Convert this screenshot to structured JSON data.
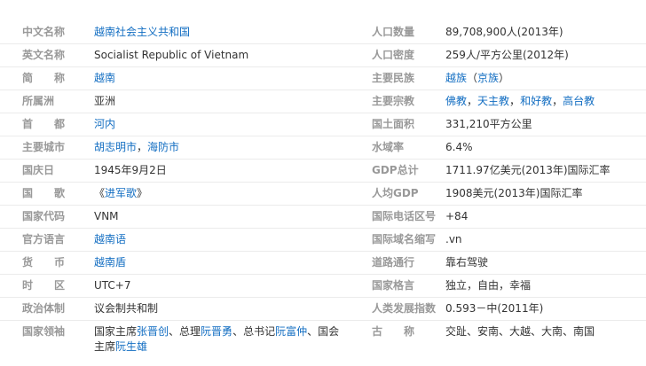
{
  "left": [
    {
      "label": "中文名称",
      "value": [
        {
          "t": "越南社会主义共和国",
          "link": true
        }
      ]
    },
    {
      "label": "英文名称",
      "value": [
        {
          "t": "Socialist Republic of Vietnam",
          "link": false
        }
      ]
    },
    {
      "label": "简　称",
      "value": [
        {
          "t": "越南",
          "link": true
        }
      ]
    },
    {
      "label": "所属洲",
      "value": [
        {
          "t": "亚洲",
          "link": false
        }
      ]
    },
    {
      "label": "首　都",
      "value": [
        {
          "t": "河内",
          "link": true
        }
      ]
    },
    {
      "label": "主要城市",
      "value": [
        {
          "t": "胡志明市",
          "link": true
        },
        {
          "t": "，",
          "link": false
        },
        {
          "t": "海防市",
          "link": true
        }
      ]
    },
    {
      "label": "国庆日",
      "value": [
        {
          "t": "1945年9月2日",
          "link": false
        }
      ]
    },
    {
      "label": "国　歌",
      "value": [
        {
          "t": "《",
          "link": false
        },
        {
          "t": "进军歌",
          "link": true
        },
        {
          "t": "》",
          "link": false
        }
      ]
    },
    {
      "label": "国家代码",
      "value": [
        {
          "t": "VNM",
          "link": false
        }
      ]
    },
    {
      "label": "官方语言",
      "value": [
        {
          "t": "越南语",
          "link": true
        }
      ]
    },
    {
      "label": "货　币",
      "value": [
        {
          "t": "越南盾",
          "link": true
        }
      ]
    },
    {
      "label": "时　区",
      "value": [
        {
          "t": "UTC+7",
          "link": false
        }
      ]
    },
    {
      "label": "政治体制",
      "value": [
        {
          "t": "议会制共和制",
          "link": false
        }
      ]
    },
    {
      "label": "国家领袖",
      "tall": true,
      "value": [
        {
          "t": "国家主席",
          "link": false
        },
        {
          "t": "张晋创",
          "link": true
        },
        {
          "t": "、总理",
          "link": false
        },
        {
          "t": "阮晋勇",
          "link": true
        },
        {
          "t": "、总书记",
          "link": false
        },
        {
          "t": "阮富仲",
          "link": true
        },
        {
          "t": "、国会主席",
          "link": false
        },
        {
          "t": "阮生雄",
          "link": true
        }
      ]
    }
  ],
  "right": [
    {
      "label": "人口数量",
      "value": [
        {
          "t": "89,708,900人(2013年)",
          "link": false
        }
      ]
    },
    {
      "label": "人口密度",
      "value": [
        {
          "t": "259人/平方公里(2012年)",
          "link": false
        }
      ]
    },
    {
      "label": "主要民族",
      "value": [
        {
          "t": "越族",
          "link": true
        },
        {
          "t": "（",
          "link": false
        },
        {
          "t": "京族",
          "link": true
        },
        {
          "t": "）",
          "link": false
        }
      ]
    },
    {
      "label": "主要宗教",
      "value": [
        {
          "t": "佛教",
          "link": true
        },
        {
          "t": "，",
          "link": false
        },
        {
          "t": "天主教",
          "link": true
        },
        {
          "t": "，",
          "link": false
        },
        {
          "t": "和好教",
          "link": true
        },
        {
          "t": "，",
          "link": false
        },
        {
          "t": "高台教",
          "link": true
        }
      ]
    },
    {
      "label": "国土面积",
      "value": [
        {
          "t": "331,210平方公里",
          "link": false
        }
      ]
    },
    {
      "label": "水域率",
      "value": [
        {
          "t": "6.4%",
          "link": false
        }
      ]
    },
    {
      "label": "GDP总计",
      "value": [
        {
          "t": "1711.97亿美元(2013年)国际汇率",
          "link": false
        }
      ]
    },
    {
      "label": "人均GDP",
      "value": [
        {
          "t": "1908美元(2013年)国际汇率",
          "link": false
        }
      ]
    },
    {
      "label": "国际电话区号",
      "value": [
        {
          "t": "+84",
          "link": false
        }
      ]
    },
    {
      "label": "国际域名缩写",
      "value": [
        {
          "t": ".vn",
          "link": false
        }
      ]
    },
    {
      "label": "道路通行",
      "value": [
        {
          "t": "靠右驾驶",
          "link": false
        }
      ]
    },
    {
      "label": "国家格言",
      "value": [
        {
          "t": "独立，自由，幸福",
          "link": false
        }
      ]
    },
    {
      "label": "人类发展指数",
      "value": [
        {
          "t": "0.593－中(2011年)",
          "link": false
        }
      ]
    },
    {
      "label": "古　称",
      "value": [
        {
          "t": "交趾、安南、大越、大南、南国",
          "link": false
        }
      ]
    }
  ]
}
